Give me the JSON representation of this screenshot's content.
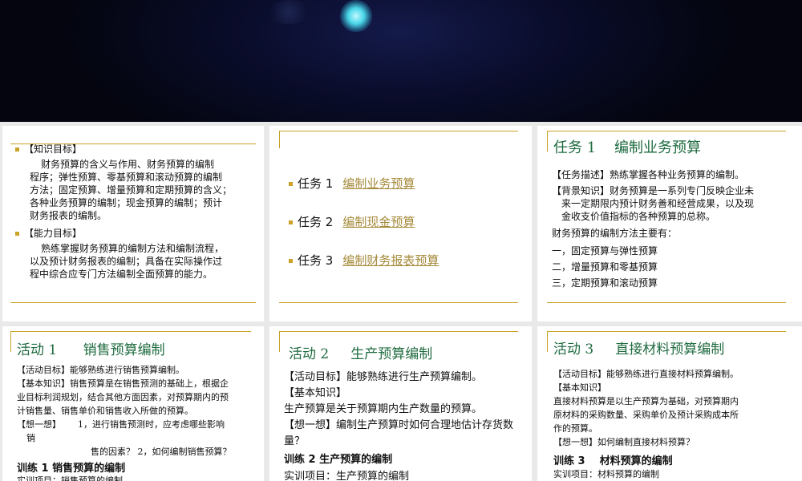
{
  "slide1": {
    "knowledge_head": "【知识目标】",
    "knowledge_lines": [
      "财务预算的含义与作用、财务预算的编制",
      "程序；弹性预算、零基预算和滚动预算的编制",
      "方法；固定预算、增量预算和定期预算的含义；",
      "各种业务预算的编制；现金预算的编制；预计",
      "财务报表的编制。"
    ],
    "ability_head": "【能力目标】",
    "ability_lines": [
      "熟练掌握财务预算的编制方法和编制流程，",
      "以及预计财务报表的编制；具备在实际操作过",
      "程中综合应专门方法编制全面预算的能力。"
    ]
  },
  "slide2": {
    "items": [
      {
        "label": "任务 1",
        "link": "编制业务预算"
      },
      {
        "label": "任务 2",
        "link": "编制现金预算"
      },
      {
        "label": "任务 3",
        "link": "编制财务报表预算"
      }
    ]
  },
  "slide3": {
    "title": "任务 1    编制业务预算",
    "desc": "【任务描述】熟练掌握各种业务预算的编制。",
    "bg_lines": [
      "【背景知识】财务预算是一系列专门反映企业未",
      "来一定期限内预计财务善和经营成果，以及现",
      "金收支价值指标的各种预算的总称。"
    ],
    "methods_head": "财务预算的编制方法主要有：",
    "methods": [
      "一，固定预算与弹性预算",
      "二，增量预算和零基预算",
      "三，定期预算和滚动预算"
    ]
  },
  "slide4": {
    "title": "活动 1      销售预算编制",
    "lines": [
      "【活动目标】能够熟练进行销售预算编制。",
      "【基本知识】销售预算是在销售预测的基础上，根据企",
      "业目标利润规划，结合其他方面因素，对预算期内的预",
      "计销售量、销售单价和销售收入所做的预算。"
    ],
    "think_a": "【想一想】      1，进行销售预测时，应考虑哪些影响",
    "think_b": "销",
    "think_c": "售的因素？ 2，如何编制销售预算？",
    "train": "训练 1   销售预算的编制",
    "train_item": "实训项目：销售预算的编制"
  },
  "slide5": {
    "title": "活动 2     生产预算编制",
    "goal": "【活动目标】能够熟练进行生产预算编制。",
    "basic": "【基本知识】",
    "basic_text": "生产预算是关于预算期内生产数量的预算。",
    "think_lines": [
      "【想一想】编制生产预算时如何合理地估计存货数",
      "量？"
    ],
    "train": "训练 2   生产预算的编制",
    "train_item": "实训项目：生产预算的编制"
  },
  "slide6": {
    "title": "活动 3     直接材料预算编制",
    "goal": "【活动目标】能够熟练进行直接材料预算编制。",
    "basic": "【基本知识】",
    "basic_lines": [
      "直接材料预算是以生产预算为基础，对预算期内",
      "原材料的采购数量、采购单价及预计采购成本所",
      "作的预算。"
    ],
    "think": "【想一想】如何编制直接材料预算？",
    "train": "训练 3    材料预算的编制",
    "train_item": "实训项目：材料预算的编制"
  }
}
